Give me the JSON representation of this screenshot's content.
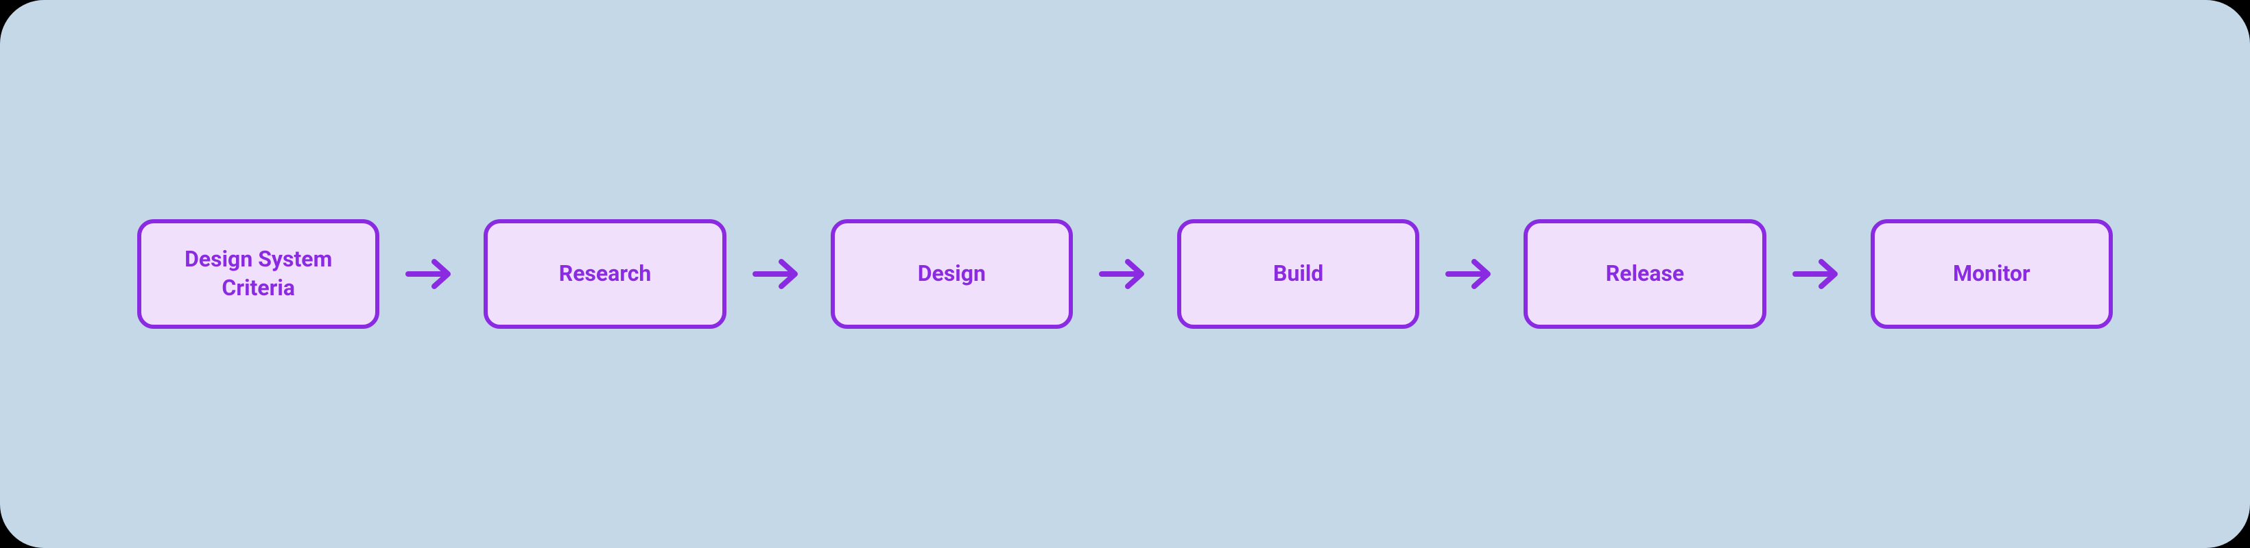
{
  "diagram": {
    "type": "process-flow",
    "steps": [
      {
        "label": "Design System Criteria"
      },
      {
        "label": "Research"
      },
      {
        "label": "Design"
      },
      {
        "label": "Build"
      },
      {
        "label": "Release"
      },
      {
        "label": "Monitor"
      }
    ],
    "colors": {
      "canvas_bg": "#c5d8e8",
      "box_bg": "#f1e0fb",
      "accent": "#8a2be2"
    }
  }
}
